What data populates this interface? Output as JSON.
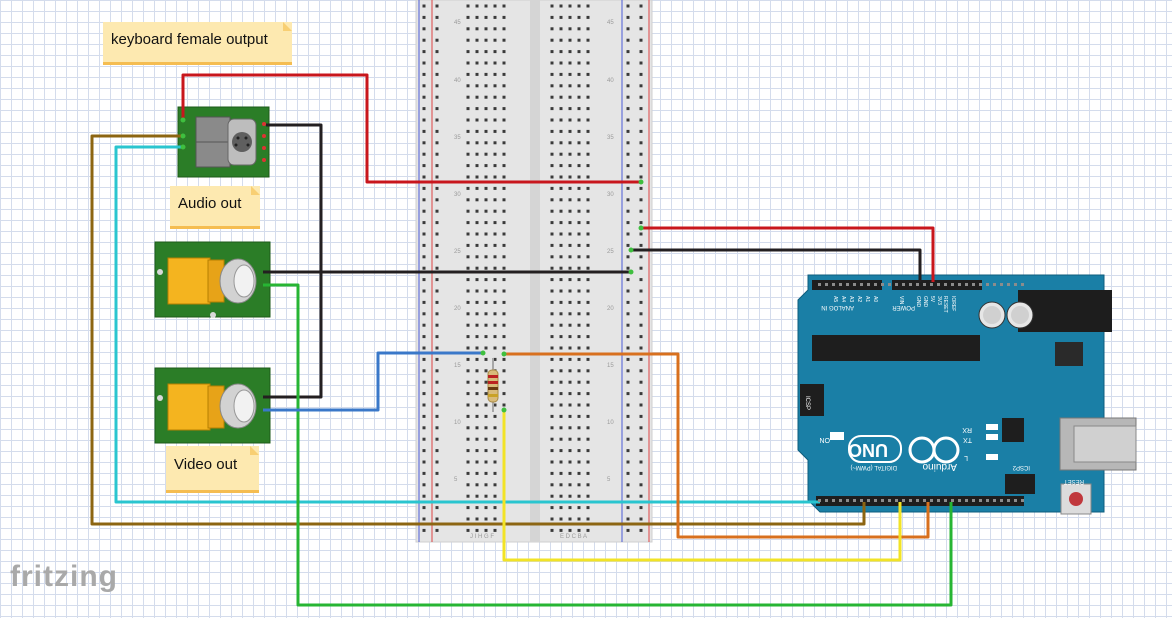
{
  "app": {
    "brand": "fritzing"
  },
  "notes": {
    "keyboard": "keyboard female output",
    "audio": "Audio out",
    "video": "Video out"
  },
  "arduino": {
    "model": "UNO",
    "brand": "Arduino",
    "digital_label": "DIGITAL (PWM~)",
    "analog_label": "ANALOG IN",
    "power_label": "POWER",
    "on_label": "ON",
    "tx_label": "TX",
    "rx_label": "RX",
    "l_label": "L",
    "icsp_label": "ICSP",
    "icsp2_label": "ICSP2",
    "reset_label": "RESET",
    "power_pins": [
      "IOREF",
      "RESET",
      "3V3",
      "5V",
      "GND",
      "GND",
      "VIN"
    ],
    "analog_pins": [
      "A0",
      "A1",
      "A2",
      "A3",
      "A4",
      "A5"
    ]
  },
  "breadboard": {
    "row_numbers": [
      "45",
      "40",
      "35",
      "30",
      "25",
      "20",
      "15",
      "10",
      "5",
      "1"
    ],
    "column_letters_left": "J I H G F",
    "column_letters_right": "E D C B A"
  },
  "colors": {
    "red": "#c8161d",
    "black": "#231f20",
    "brown": "#8c6512",
    "cyan": "#29c5cf",
    "green": "#27b533",
    "blue": "#3a78c9",
    "orange": "#d8701e",
    "yellow": "#f2e326",
    "board": "#1a7fa6",
    "pcb": "#2b7d27"
  }
}
